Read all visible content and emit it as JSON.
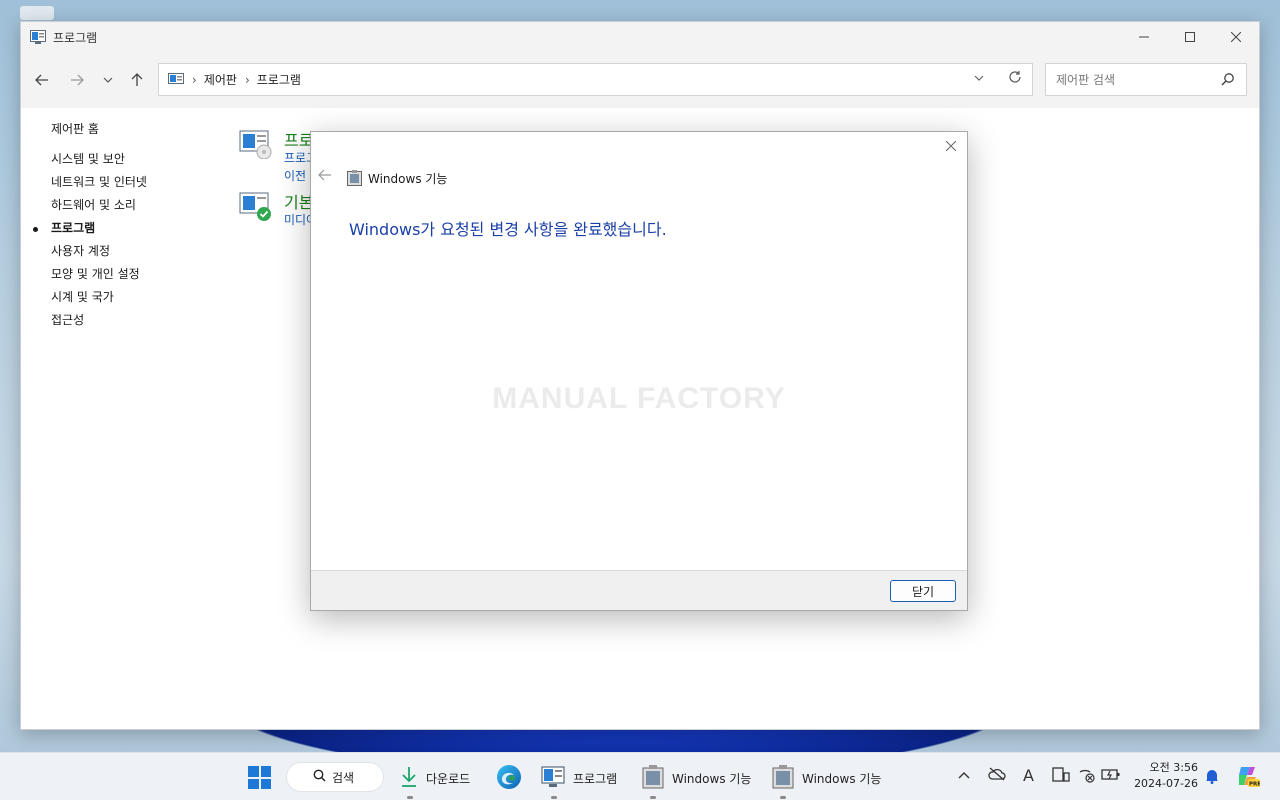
{
  "window": {
    "title": "프로그램",
    "controls": [
      "minimize",
      "maximize",
      "close"
    ]
  },
  "address_bar": {
    "breadcrumb": [
      "제어판",
      "프로그램"
    ],
    "separator": "›"
  },
  "search": {
    "placeholder": "제어판 검색"
  },
  "sidebar": {
    "home": "제어판 홈",
    "items": [
      {
        "label": "시스템 및 보안",
        "active": false
      },
      {
        "label": "네트워크 및 인터넷",
        "active": false
      },
      {
        "label": "하드웨어 및 소리",
        "active": false
      },
      {
        "label": "프로그램",
        "active": true
      },
      {
        "label": "사용자 계정",
        "active": false
      },
      {
        "label": "모양 및 개인 설정",
        "active": false
      },
      {
        "label": "시계 및 국가",
        "active": false
      },
      {
        "label": "접근성",
        "active": false
      }
    ]
  },
  "categories": [
    {
      "title": "프로그램 및 기능",
      "links": [
        "프로그",
        "이전"
      ]
    },
    {
      "title": "기본",
      "links": [
        "미디어"
      ]
    }
  ],
  "dialog": {
    "title": "Windows 기능",
    "message": "Windows가 요청된 변경 사항을 완료했습니다.",
    "watermark": "MANUAL FACTORY",
    "close_button": "닫기"
  },
  "taskbar": {
    "search_label": "검색",
    "apps": [
      {
        "label": "다운로드",
        "icon": "download-icon"
      },
      {
        "label": "",
        "icon": "edge-icon"
      },
      {
        "label": "프로그램",
        "icon": "control-panel-icon"
      },
      {
        "label": "Windows 기능",
        "icon": "windows-features-icon"
      },
      {
        "label": "Windows 기능",
        "icon": "windows-features-icon"
      }
    ],
    "tray_icons": [
      "chevron-up-icon",
      "onedrive-icon",
      "ime-icon",
      "device-icon",
      "network-icon",
      "battery-icon"
    ],
    "ime_label": "A",
    "clock": {
      "time": "오전 3:56",
      "date": "2024-07-26"
    }
  },
  "colors": {
    "link_blue": "#1a5fb4",
    "category_green": "#1a7f1a",
    "dialog_message": "#1a3fa8",
    "start_blue": "#1e78d7"
  }
}
